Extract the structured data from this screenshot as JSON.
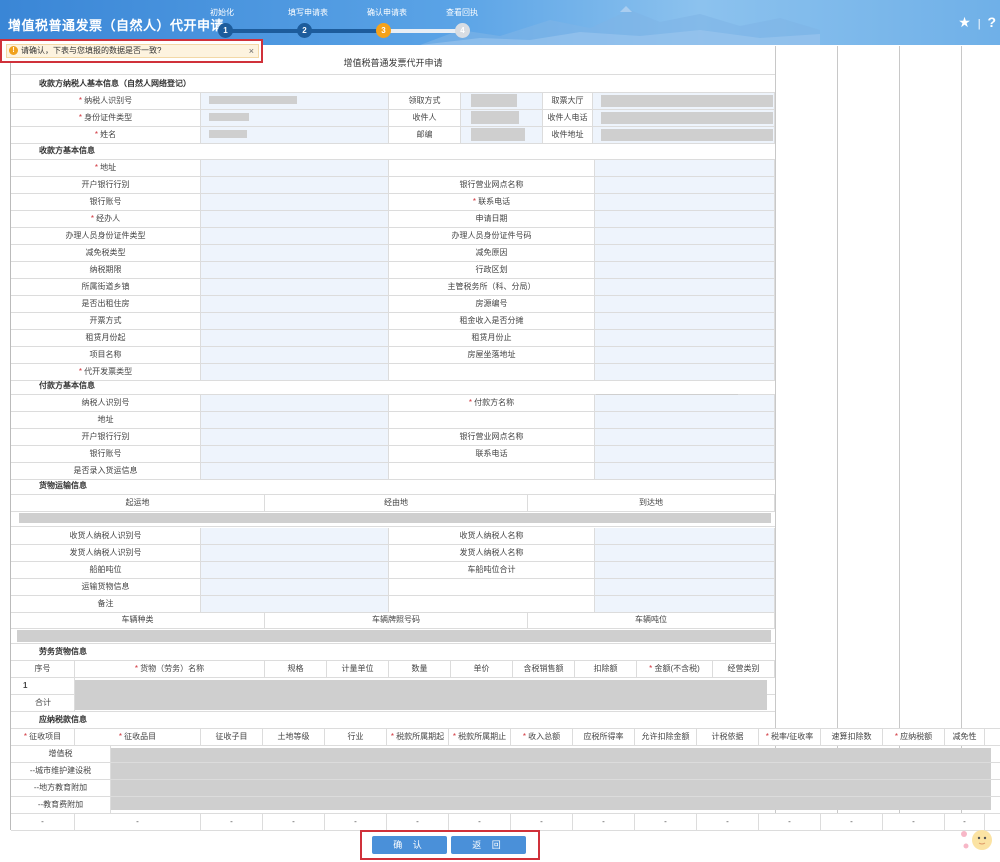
{
  "header": {
    "title": "增值税普通发票（自然人）代开申请",
    "steps": [
      {
        "num": "1",
        "label": "初始化"
      },
      {
        "num": "2",
        "label": "填写申请表"
      },
      {
        "num": "3",
        "label": "确认申请表"
      },
      {
        "num": "4",
        "label": "查看回执"
      }
    ],
    "icons": {
      "favorite": "★",
      "separator": "|",
      "help": "?"
    }
  },
  "alert": {
    "text": "请确认，下表与您填报的数据是否一致?",
    "icon": "!",
    "close": "×"
  },
  "form": {
    "title": "增值税普通发票代开申请",
    "payee_section": "收款方纳税人基本信息（自然人网络登记）",
    "payee_rows": [
      {
        "l1": "纳税人识别号",
        "l2": "领取方式",
        "l3": "取票大厅"
      },
      {
        "l1": "身份证件类型",
        "l2": "收件人",
        "l3": "收件人电话"
      },
      {
        "l1": "姓名",
        "l2": "邮编",
        "l3": "收件地址"
      }
    ],
    "payee_basic_section": "收款方基本信息",
    "payee_basic_rows": [
      {
        "l1": "地址",
        "r1": true,
        "l2": ""
      },
      {
        "l1": "开户银行行别",
        "l2": "银行营业网点名称"
      },
      {
        "l1": "银行账号",
        "l2": "联系电话",
        "r2": true
      },
      {
        "l1": "经办人",
        "r1": true,
        "l2": "申请日期"
      },
      {
        "l1": "办理人员身份证件类型",
        "l2": "办理人员身份证件号码"
      },
      {
        "l1": "减免税类型",
        "l2": "减免原因"
      },
      {
        "l1": "纳税期限",
        "l2": "行政区划"
      },
      {
        "l1": "所属街道乡镇",
        "l2": "主管税务所（科、分局）"
      },
      {
        "l1": "是否出租住房",
        "l2": "房源编号"
      },
      {
        "l1": "开票方式",
        "l2": "租金收入是否分摊"
      },
      {
        "l1": "租赁月份起",
        "l2": "租赁月份止"
      },
      {
        "l1": "项目名称",
        "l2": "房屋坐落地址"
      },
      {
        "l1": "代开发票类型",
        "r1": true,
        "l2": ""
      }
    ],
    "payer_section": "付款方基本信息",
    "payer_rows": [
      {
        "l1": "纳税人识别号",
        "l2": "付款方名称",
        "r2": true
      },
      {
        "l1": "地址",
        "l2": ""
      },
      {
        "l1": "开户银行行别",
        "l2": "银行营业网点名称"
      },
      {
        "l1": "银行账号",
        "l2": "联系电话"
      },
      {
        "l1": "是否录入货运信息",
        "l2": ""
      }
    ],
    "transport_section": "货物运输信息",
    "transport_headers": [
      "起运地",
      "经由地",
      "到达地"
    ],
    "transport_rows": [
      {
        "l1": "收货人纳税人识别号",
        "l2": "收货人纳税人名称"
      },
      {
        "l1": "发货人纳税人识别号",
        "l2": "发货人纳税人名称"
      },
      {
        "l1": "船舶吨位",
        "l2": "车船吨位合计"
      },
      {
        "l1": "运输货物信息",
        "l2": ""
      },
      {
        "l1": "备注",
        "l2": ""
      }
    ],
    "vehicle_headers": [
      "车辆种类",
      "车辆牌照号码",
      "车辆吨位"
    ],
    "goods_section": "劳务货物信息",
    "goods_headers": [
      {
        "t": "序号",
        "r": false
      },
      {
        "t": "货物（劳务）名称",
        "r": true
      },
      {
        "t": "规格",
        "r": false
      },
      {
        "t": "计量单位",
        "r": false
      },
      {
        "t": "数量",
        "r": false
      },
      {
        "t": "单价",
        "r": false
      },
      {
        "t": "含税销售额",
        "r": false
      },
      {
        "t": "扣除额",
        "r": false
      },
      {
        "t": "金额(不含税)",
        "r": true
      },
      {
        "t": "经营类别",
        "r": false
      }
    ],
    "goods_row_num": "1",
    "goods_total": "合计",
    "tax_section": "应纳税款信息",
    "tax_headers": [
      {
        "t": "征收项目",
        "r": true
      },
      {
        "t": "征收品目",
        "r": true
      },
      {
        "t": "征收子目",
        "r": false
      },
      {
        "t": "土地等级",
        "r": false
      },
      {
        "t": "行业",
        "r": false
      },
      {
        "t": "税款所属期起",
        "r": true
      },
      {
        "t": "税款所属期止",
        "r": true
      },
      {
        "t": "收入总额",
        "r": true
      },
      {
        "t": "应税所得率",
        "r": false
      },
      {
        "t": "允许扣除金额",
        "r": false
      },
      {
        "t": "计税依据",
        "r": false
      },
      {
        "t": "税率/征收率",
        "r": true
      },
      {
        "t": "速算扣除数",
        "r": false
      },
      {
        "t": "应纳税额",
        "r": true
      },
      {
        "t": "减免性",
        "r": false
      }
    ],
    "tax_rows": [
      "增值税",
      "--城市维护建设税",
      "--地方教育附加",
      "--教育费附加"
    ],
    "tax_dash": "-"
  },
  "buttons": {
    "confirm": "确 认",
    "back": "返 回"
  }
}
